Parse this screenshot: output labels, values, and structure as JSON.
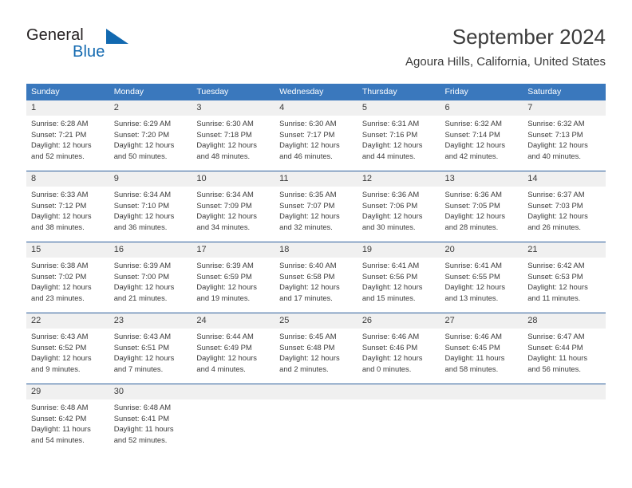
{
  "brand": {
    "name_part1": "General",
    "name_part2": "Blue",
    "accent_color": "#1269b0",
    "logo_icon": "triangle-flag-icon"
  },
  "header": {
    "title": "September 2024",
    "subtitle": "Agoura Hills, California, United States"
  },
  "colors": {
    "header_row_bg": "#3a78bd",
    "daynum_bg": "#f0f0f0",
    "row_separator": "#2b5d9b",
    "text": "#3b3b3b"
  },
  "weekdays": [
    "Sunday",
    "Monday",
    "Tuesday",
    "Wednesday",
    "Thursday",
    "Friday",
    "Saturday"
  ],
  "weeks": [
    [
      {
        "day": "1",
        "sunrise": "Sunrise: 6:28 AM",
        "sunset": "Sunset: 7:21 PM",
        "daylight_line1": "Daylight: 12 hours",
        "daylight_line2": "and 52 minutes."
      },
      {
        "day": "2",
        "sunrise": "Sunrise: 6:29 AM",
        "sunset": "Sunset: 7:20 PM",
        "daylight_line1": "Daylight: 12 hours",
        "daylight_line2": "and 50 minutes."
      },
      {
        "day": "3",
        "sunrise": "Sunrise: 6:30 AM",
        "sunset": "Sunset: 7:18 PM",
        "daylight_line1": "Daylight: 12 hours",
        "daylight_line2": "and 48 minutes."
      },
      {
        "day": "4",
        "sunrise": "Sunrise: 6:30 AM",
        "sunset": "Sunset: 7:17 PM",
        "daylight_line1": "Daylight: 12 hours",
        "daylight_line2": "and 46 minutes."
      },
      {
        "day": "5",
        "sunrise": "Sunrise: 6:31 AM",
        "sunset": "Sunset: 7:16 PM",
        "daylight_line1": "Daylight: 12 hours",
        "daylight_line2": "and 44 minutes."
      },
      {
        "day": "6",
        "sunrise": "Sunrise: 6:32 AM",
        "sunset": "Sunset: 7:14 PM",
        "daylight_line1": "Daylight: 12 hours",
        "daylight_line2": "and 42 minutes."
      },
      {
        "day": "7",
        "sunrise": "Sunrise: 6:32 AM",
        "sunset": "Sunset: 7:13 PM",
        "daylight_line1": "Daylight: 12 hours",
        "daylight_line2": "and 40 minutes."
      }
    ],
    [
      {
        "day": "8",
        "sunrise": "Sunrise: 6:33 AM",
        "sunset": "Sunset: 7:12 PM",
        "daylight_line1": "Daylight: 12 hours",
        "daylight_line2": "and 38 minutes."
      },
      {
        "day": "9",
        "sunrise": "Sunrise: 6:34 AM",
        "sunset": "Sunset: 7:10 PM",
        "daylight_line1": "Daylight: 12 hours",
        "daylight_line2": "and 36 minutes."
      },
      {
        "day": "10",
        "sunrise": "Sunrise: 6:34 AM",
        "sunset": "Sunset: 7:09 PM",
        "daylight_line1": "Daylight: 12 hours",
        "daylight_line2": "and 34 minutes."
      },
      {
        "day": "11",
        "sunrise": "Sunrise: 6:35 AM",
        "sunset": "Sunset: 7:07 PM",
        "daylight_line1": "Daylight: 12 hours",
        "daylight_line2": "and 32 minutes."
      },
      {
        "day": "12",
        "sunrise": "Sunrise: 6:36 AM",
        "sunset": "Sunset: 7:06 PM",
        "daylight_line1": "Daylight: 12 hours",
        "daylight_line2": "and 30 minutes."
      },
      {
        "day": "13",
        "sunrise": "Sunrise: 6:36 AM",
        "sunset": "Sunset: 7:05 PM",
        "daylight_line1": "Daylight: 12 hours",
        "daylight_line2": "and 28 minutes."
      },
      {
        "day": "14",
        "sunrise": "Sunrise: 6:37 AM",
        "sunset": "Sunset: 7:03 PM",
        "daylight_line1": "Daylight: 12 hours",
        "daylight_line2": "and 26 minutes."
      }
    ],
    [
      {
        "day": "15",
        "sunrise": "Sunrise: 6:38 AM",
        "sunset": "Sunset: 7:02 PM",
        "daylight_line1": "Daylight: 12 hours",
        "daylight_line2": "and 23 minutes."
      },
      {
        "day": "16",
        "sunrise": "Sunrise: 6:39 AM",
        "sunset": "Sunset: 7:00 PM",
        "daylight_line1": "Daylight: 12 hours",
        "daylight_line2": "and 21 minutes."
      },
      {
        "day": "17",
        "sunrise": "Sunrise: 6:39 AM",
        "sunset": "Sunset: 6:59 PM",
        "daylight_line1": "Daylight: 12 hours",
        "daylight_line2": "and 19 minutes."
      },
      {
        "day": "18",
        "sunrise": "Sunrise: 6:40 AM",
        "sunset": "Sunset: 6:58 PM",
        "daylight_line1": "Daylight: 12 hours",
        "daylight_line2": "and 17 minutes."
      },
      {
        "day": "19",
        "sunrise": "Sunrise: 6:41 AM",
        "sunset": "Sunset: 6:56 PM",
        "daylight_line1": "Daylight: 12 hours",
        "daylight_line2": "and 15 minutes."
      },
      {
        "day": "20",
        "sunrise": "Sunrise: 6:41 AM",
        "sunset": "Sunset: 6:55 PM",
        "daylight_line1": "Daylight: 12 hours",
        "daylight_line2": "and 13 minutes."
      },
      {
        "day": "21",
        "sunrise": "Sunrise: 6:42 AM",
        "sunset": "Sunset: 6:53 PM",
        "daylight_line1": "Daylight: 12 hours",
        "daylight_line2": "and 11 minutes."
      }
    ],
    [
      {
        "day": "22",
        "sunrise": "Sunrise: 6:43 AM",
        "sunset": "Sunset: 6:52 PM",
        "daylight_line1": "Daylight: 12 hours",
        "daylight_line2": "and 9 minutes."
      },
      {
        "day": "23",
        "sunrise": "Sunrise: 6:43 AM",
        "sunset": "Sunset: 6:51 PM",
        "daylight_line1": "Daylight: 12 hours",
        "daylight_line2": "and 7 minutes."
      },
      {
        "day": "24",
        "sunrise": "Sunrise: 6:44 AM",
        "sunset": "Sunset: 6:49 PM",
        "daylight_line1": "Daylight: 12 hours",
        "daylight_line2": "and 4 minutes."
      },
      {
        "day": "25",
        "sunrise": "Sunrise: 6:45 AM",
        "sunset": "Sunset: 6:48 PM",
        "daylight_line1": "Daylight: 12 hours",
        "daylight_line2": "and 2 minutes."
      },
      {
        "day": "26",
        "sunrise": "Sunrise: 6:46 AM",
        "sunset": "Sunset: 6:46 PM",
        "daylight_line1": "Daylight: 12 hours",
        "daylight_line2": "and 0 minutes."
      },
      {
        "day": "27",
        "sunrise": "Sunrise: 6:46 AM",
        "sunset": "Sunset: 6:45 PM",
        "daylight_line1": "Daylight: 11 hours",
        "daylight_line2": "and 58 minutes."
      },
      {
        "day": "28",
        "sunrise": "Sunrise: 6:47 AM",
        "sunset": "Sunset: 6:44 PM",
        "daylight_line1": "Daylight: 11 hours",
        "daylight_line2": "and 56 minutes."
      }
    ],
    [
      {
        "day": "29",
        "sunrise": "Sunrise: 6:48 AM",
        "sunset": "Sunset: 6:42 PM",
        "daylight_line1": "Daylight: 11 hours",
        "daylight_line2": "and 54 minutes."
      },
      {
        "day": "30",
        "sunrise": "Sunrise: 6:48 AM",
        "sunset": "Sunset: 6:41 PM",
        "daylight_line1": "Daylight: 11 hours",
        "daylight_line2": "and 52 minutes."
      },
      {
        "day": "",
        "sunrise": "",
        "sunset": "",
        "daylight_line1": "",
        "daylight_line2": ""
      },
      {
        "day": "",
        "sunrise": "",
        "sunset": "",
        "daylight_line1": "",
        "daylight_line2": ""
      },
      {
        "day": "",
        "sunrise": "",
        "sunset": "",
        "daylight_line1": "",
        "daylight_line2": ""
      },
      {
        "day": "",
        "sunrise": "",
        "sunset": "",
        "daylight_line1": "",
        "daylight_line2": ""
      },
      {
        "day": "",
        "sunrise": "",
        "sunset": "",
        "daylight_line1": "",
        "daylight_line2": ""
      }
    ]
  ]
}
